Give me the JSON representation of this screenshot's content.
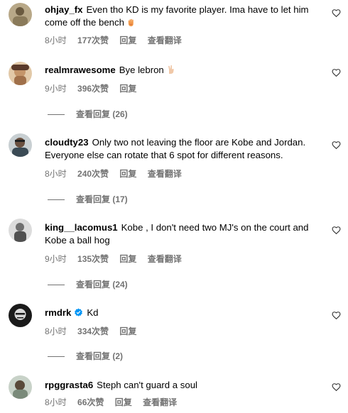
{
  "comments": [
    {
      "username": "ohjay_fx",
      "text": "Even tho KD is my favorite player. Ima have to let him come off the bench",
      "emoji": "hand-emoji",
      "time": "8小时",
      "likes": "177次赞",
      "reply": "回复",
      "translate": "查看翻译",
      "avatar_color": "#8a7a5a"
    },
    {
      "username": "realmrawesome",
      "text": "Bye lebron",
      "emoji": "peace-hand-emoji",
      "time": "9小时",
      "likes": "396次赞",
      "reply": "回复",
      "view_replies": "查看回复 (26)",
      "avatar_color": "#c4956a"
    },
    {
      "username": "cloudty23",
      "text": "Only two not leaving the floor are Kobe and Jordan. Everyone else can rotate that 6 spot for different reasons.",
      "time": "8小时",
      "likes": "240次赞",
      "reply": "回复",
      "translate": "查看翻译",
      "view_replies": "查看回复 (17)",
      "avatar_color": "#5a6a70"
    },
    {
      "username": "king__lacomus1",
      "text": "Kobe , I don't need two MJ's on the court and Kobe a ball hog",
      "time": "9小时",
      "likes": "135次赞",
      "reply": "回复",
      "translate": "查看翻译",
      "view_replies": "查看回复 (24)",
      "avatar_color": "#9a9a9a"
    },
    {
      "username": "rmdrk",
      "verified": true,
      "text": "Kd",
      "time": "8小时",
      "likes": "334次赞",
      "reply": "回复",
      "view_replies": "查看回复 (2)",
      "avatar_color": "#1a1a1a"
    },
    {
      "username": "rpggrasta6",
      "text": "Steph can't guard a soul",
      "time": "8小时",
      "likes": "66次赞",
      "reply": "回复",
      "translate": "查看翻译",
      "avatar_color": "#7a8a7a"
    }
  ],
  "icons": {
    "like": "heart-outline-icon",
    "verified": "verified-badge-icon"
  },
  "colors": {
    "meta_text": "#737373",
    "verified_blue": "#0095f6"
  }
}
